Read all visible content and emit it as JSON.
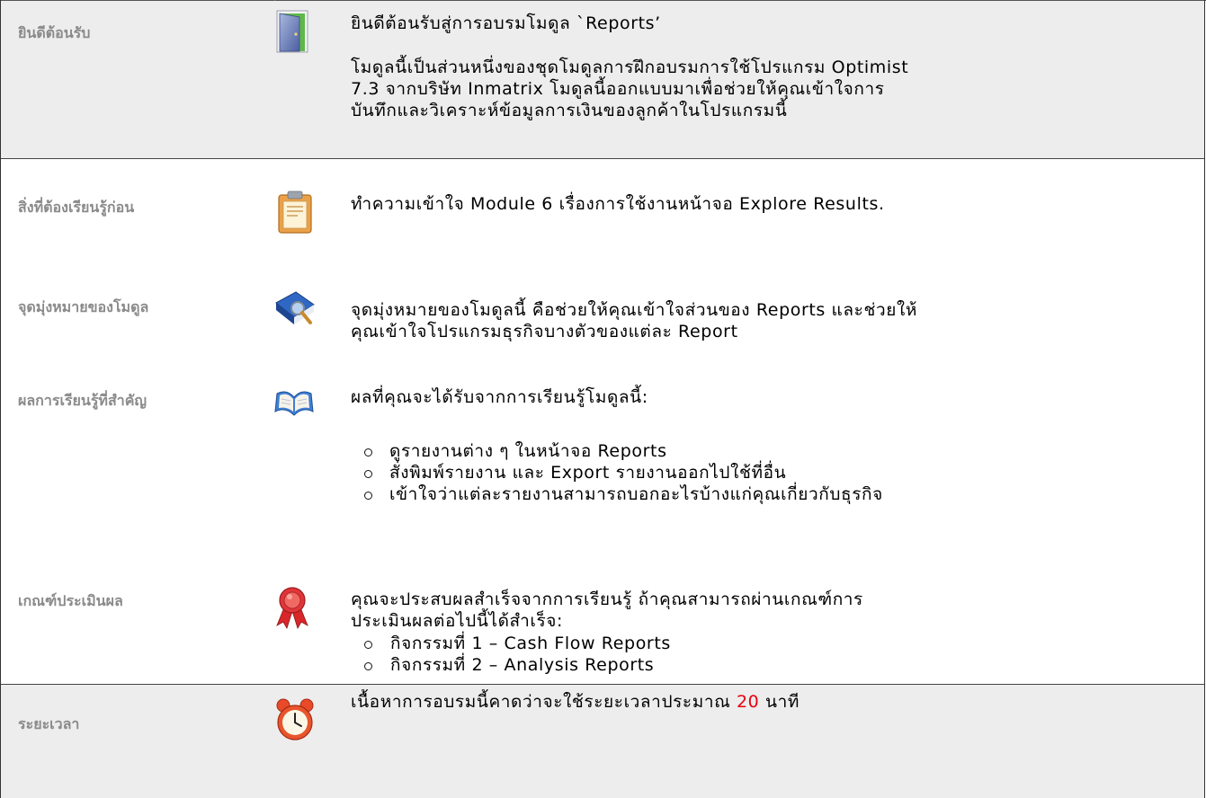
{
  "rows": {
    "welcome": {
      "label": "ยินดีต้อนรับ",
      "icon": "door-icon",
      "title": "ยินดีต้อนรับสู่การอบรมโมดูล `Reports’",
      "lines": [
        "โมดูลนี้เป็นส่วนหนึ่งของชุดโมดูลการฝึกอบรมการใช้โปรแกรม Optimist",
        "7.3  จากบริษัท Inmatrix โมดูลนี้ออกแบบมาเพื่อช่วยให้คุณเข้าใจการ",
        "บันทึกและวิเคราะห์ข้อมูลการเงินของลูกค้าในโปรแกรมนี้"
      ]
    },
    "prerequisites": {
      "label": "สิ่งที่ต้องเรียนรู้ก่อน",
      "icon": "clipboard-icon",
      "text": "ทำความเข้าใจ Module 6 เรื่องการใช้งานหน้าจอ Explore Results."
    },
    "objectives": {
      "label": "จุดมุ่งหมายของโมดูล",
      "icon": "magnifier-book-icon",
      "lines": [
        "จุดมุ่งหมายของโมดูลนี้ คือช่วยให้คุณเข้าใจส่วนของ Reports และช่วยให้",
        "คุณเข้าใจโปรแกรมธุรกิจบางตัวของแต่ละ Report"
      ]
    },
    "outcomes": {
      "label": "ผลการเรียนรู้ที่สำคัญ",
      "icon": "open-book-icon",
      "intro": "ผลที่คุณจะได้รับจากการเรียนรู้โมดูลนี้:",
      "bullets": [
        "ดูรายงานต่าง ๆ ในหน้าจอ Reports",
        "สั่งพิมพ์รายงาน และ Export รายงานออกไปใช้ที่อื่น",
        "เข้าใจว่าแต่ละรายงานสามารถบอกอะไรบ้างแก่คุณเกี่ยวกับธุรกิจ"
      ]
    },
    "assessment": {
      "label": "เกณฑ์ประเมินผล",
      "icon": "award-ribbon-icon",
      "lines": [
        "คุณจะประสบผลสำเร็จจากการเรียนรู้ ถ้าคุณสามารถผ่านเกณฑ์การ",
        "ประเมินผลต่อไปนี้ได้สำเร็จ:"
      ],
      "bullets": [
        "กิจกรรมที่ 1 – Cash Flow Reports",
        "กิจกรรมที่ 2 – Analysis Reports"
      ]
    },
    "duration": {
      "label": "ระยะเวลา",
      "icon": "alarm-clock-icon",
      "text_before": "เนื้อหาการอบรมนี้คาดว่าจะใช้ระยะเวลาประมาณ ",
      "minutes": "20",
      "text_after": " นาที",
      "highlight_color": "#e8000e"
    }
  }
}
